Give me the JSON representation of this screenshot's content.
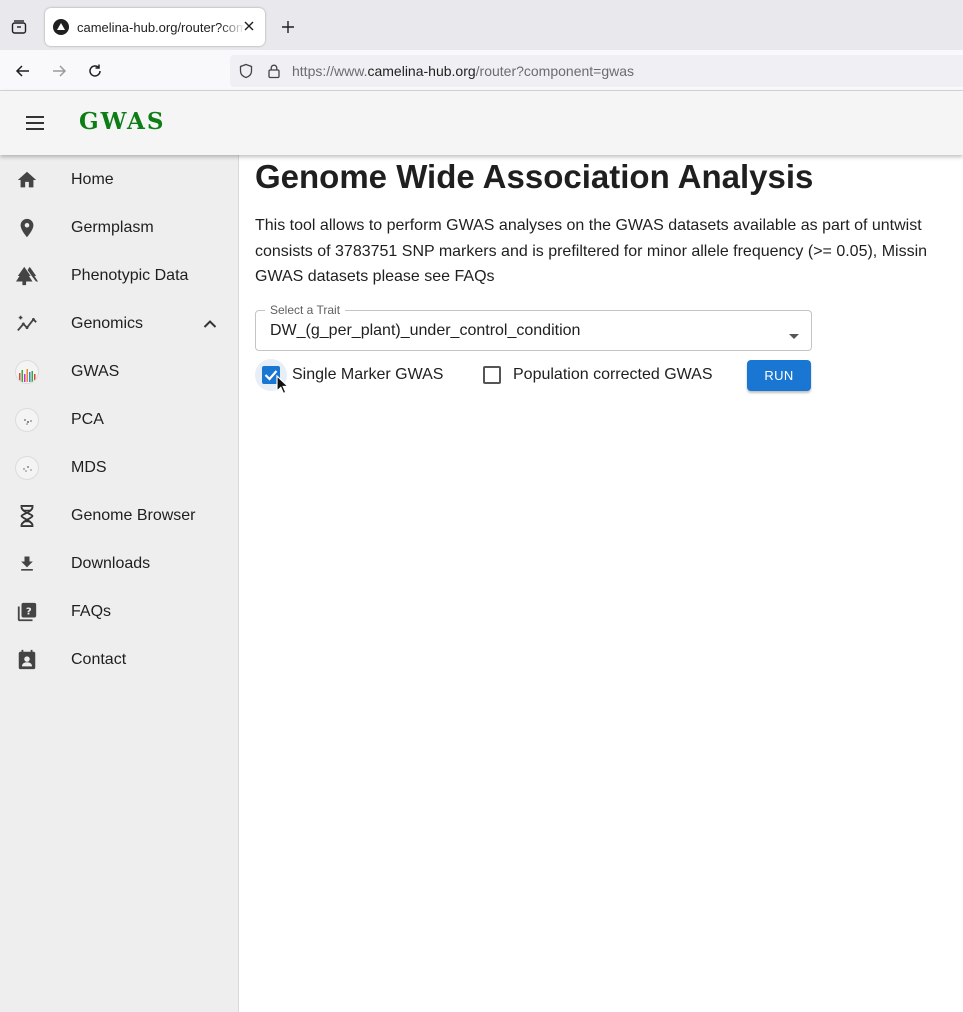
{
  "browser": {
    "tab_title": "camelina-hub.org/router?component=gwas",
    "url_prefix": "https://www.",
    "url_host": "camelina-hub.org",
    "url_path": "/router?component=gwas"
  },
  "header": {
    "app_title": "GWAS"
  },
  "sidebar": {
    "items": [
      {
        "label": "Home",
        "icon": "home-icon"
      },
      {
        "label": "Germplasm",
        "icon": "location-pin-icon"
      },
      {
        "label": "Phenotypic Data",
        "icon": "forest-icon"
      },
      {
        "label": "Genomics",
        "icon": "genomics-icon",
        "expanded": true
      },
      {
        "label": "GWAS",
        "icon": "gwas-thumbnail-icon"
      },
      {
        "label": "PCA",
        "icon": "pca-thumbnail-icon"
      },
      {
        "label": "MDS",
        "icon": "mds-thumbnail-icon"
      },
      {
        "label": "Genome Browser",
        "icon": "dna-icon"
      },
      {
        "label": "Downloads",
        "icon": "download-icon"
      },
      {
        "label": "FAQs",
        "icon": "faq-icon"
      },
      {
        "label": "Contact",
        "icon": "contact-icon"
      }
    ]
  },
  "main": {
    "title": "Genome Wide Association Analysis",
    "description": [
      "This tool allows to perform GWAS analyses on the GWAS datasets available as part of untwist",
      "consists of 3783751 SNP markers and is prefiltered for minor allele frequency (>= 0.05), Missin",
      "GWAS datasets please see FAQs"
    ],
    "trait_select": {
      "label": "Select a Trait",
      "value": "DW_(g_per_plant)_under_control_condition"
    },
    "options": {
      "single_marker_label": "Single Marker GWAS",
      "single_marker_checked": true,
      "population_corrected_label": "Population corrected GWAS",
      "population_corrected_checked": false
    },
    "run_label": "RUN"
  },
  "colors": {
    "brand_green": "#0d7d15",
    "primary_blue": "#1976d2"
  }
}
